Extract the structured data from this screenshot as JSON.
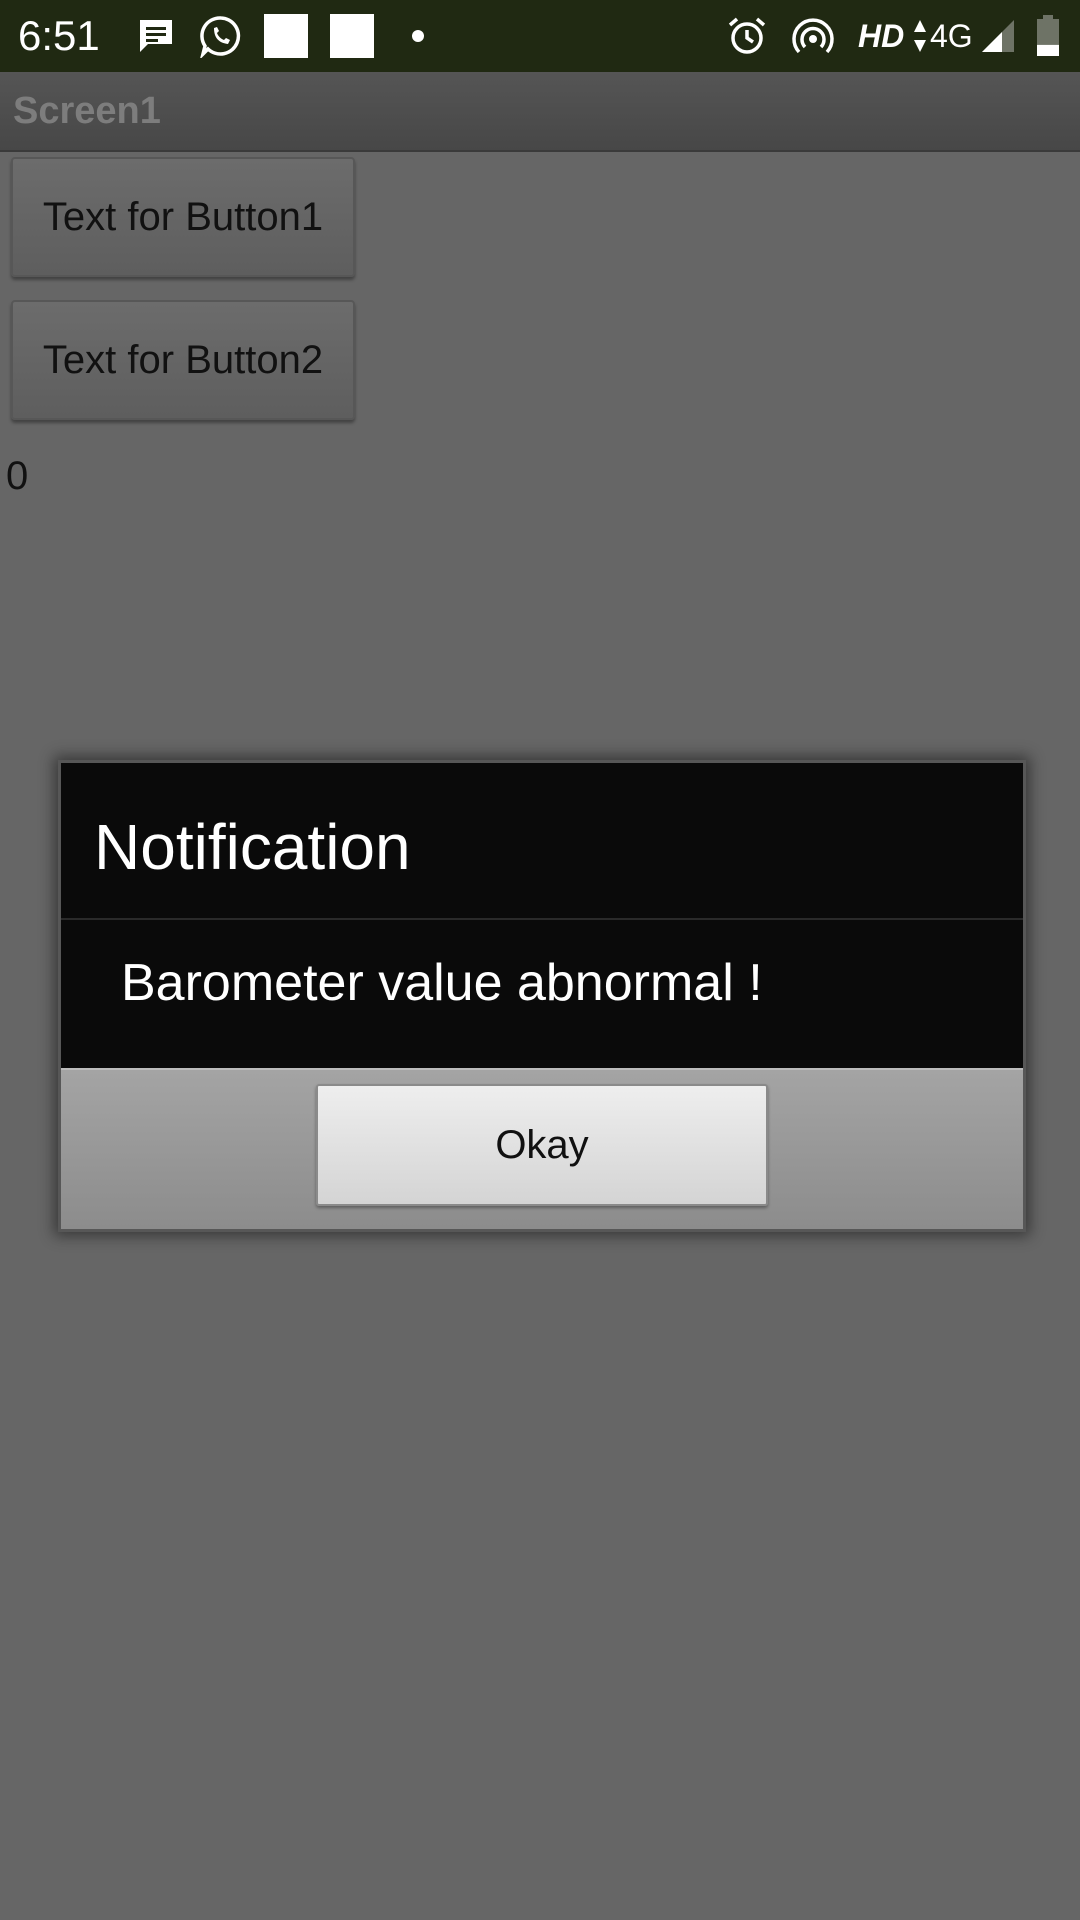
{
  "status_bar": {
    "time": "6:51",
    "hd_label": "HD",
    "network_label": "4G",
    "icons": [
      "message-icon",
      "whatsapp-icon",
      "notification-square-icon",
      "notification-square-icon",
      "more-notifications-dot-icon",
      "alarm-icon",
      "hotspot-icon",
      "data-arrows-icon",
      "signal-icon",
      "battery-icon"
    ],
    "battery_level": 0.3
  },
  "app_bar": {
    "title": "Screen1"
  },
  "content": {
    "button1_label": "Text for Button1",
    "button2_label": "Text for Button2",
    "counter_value": "0"
  },
  "dialog": {
    "title": "Notification",
    "message": "Barometer value abnormal !",
    "ok_label": "Okay"
  },
  "colors": {
    "status_bar_bg": "#202912",
    "screen_bg": "#666666",
    "dialog_bg": "#0a0a0a"
  }
}
